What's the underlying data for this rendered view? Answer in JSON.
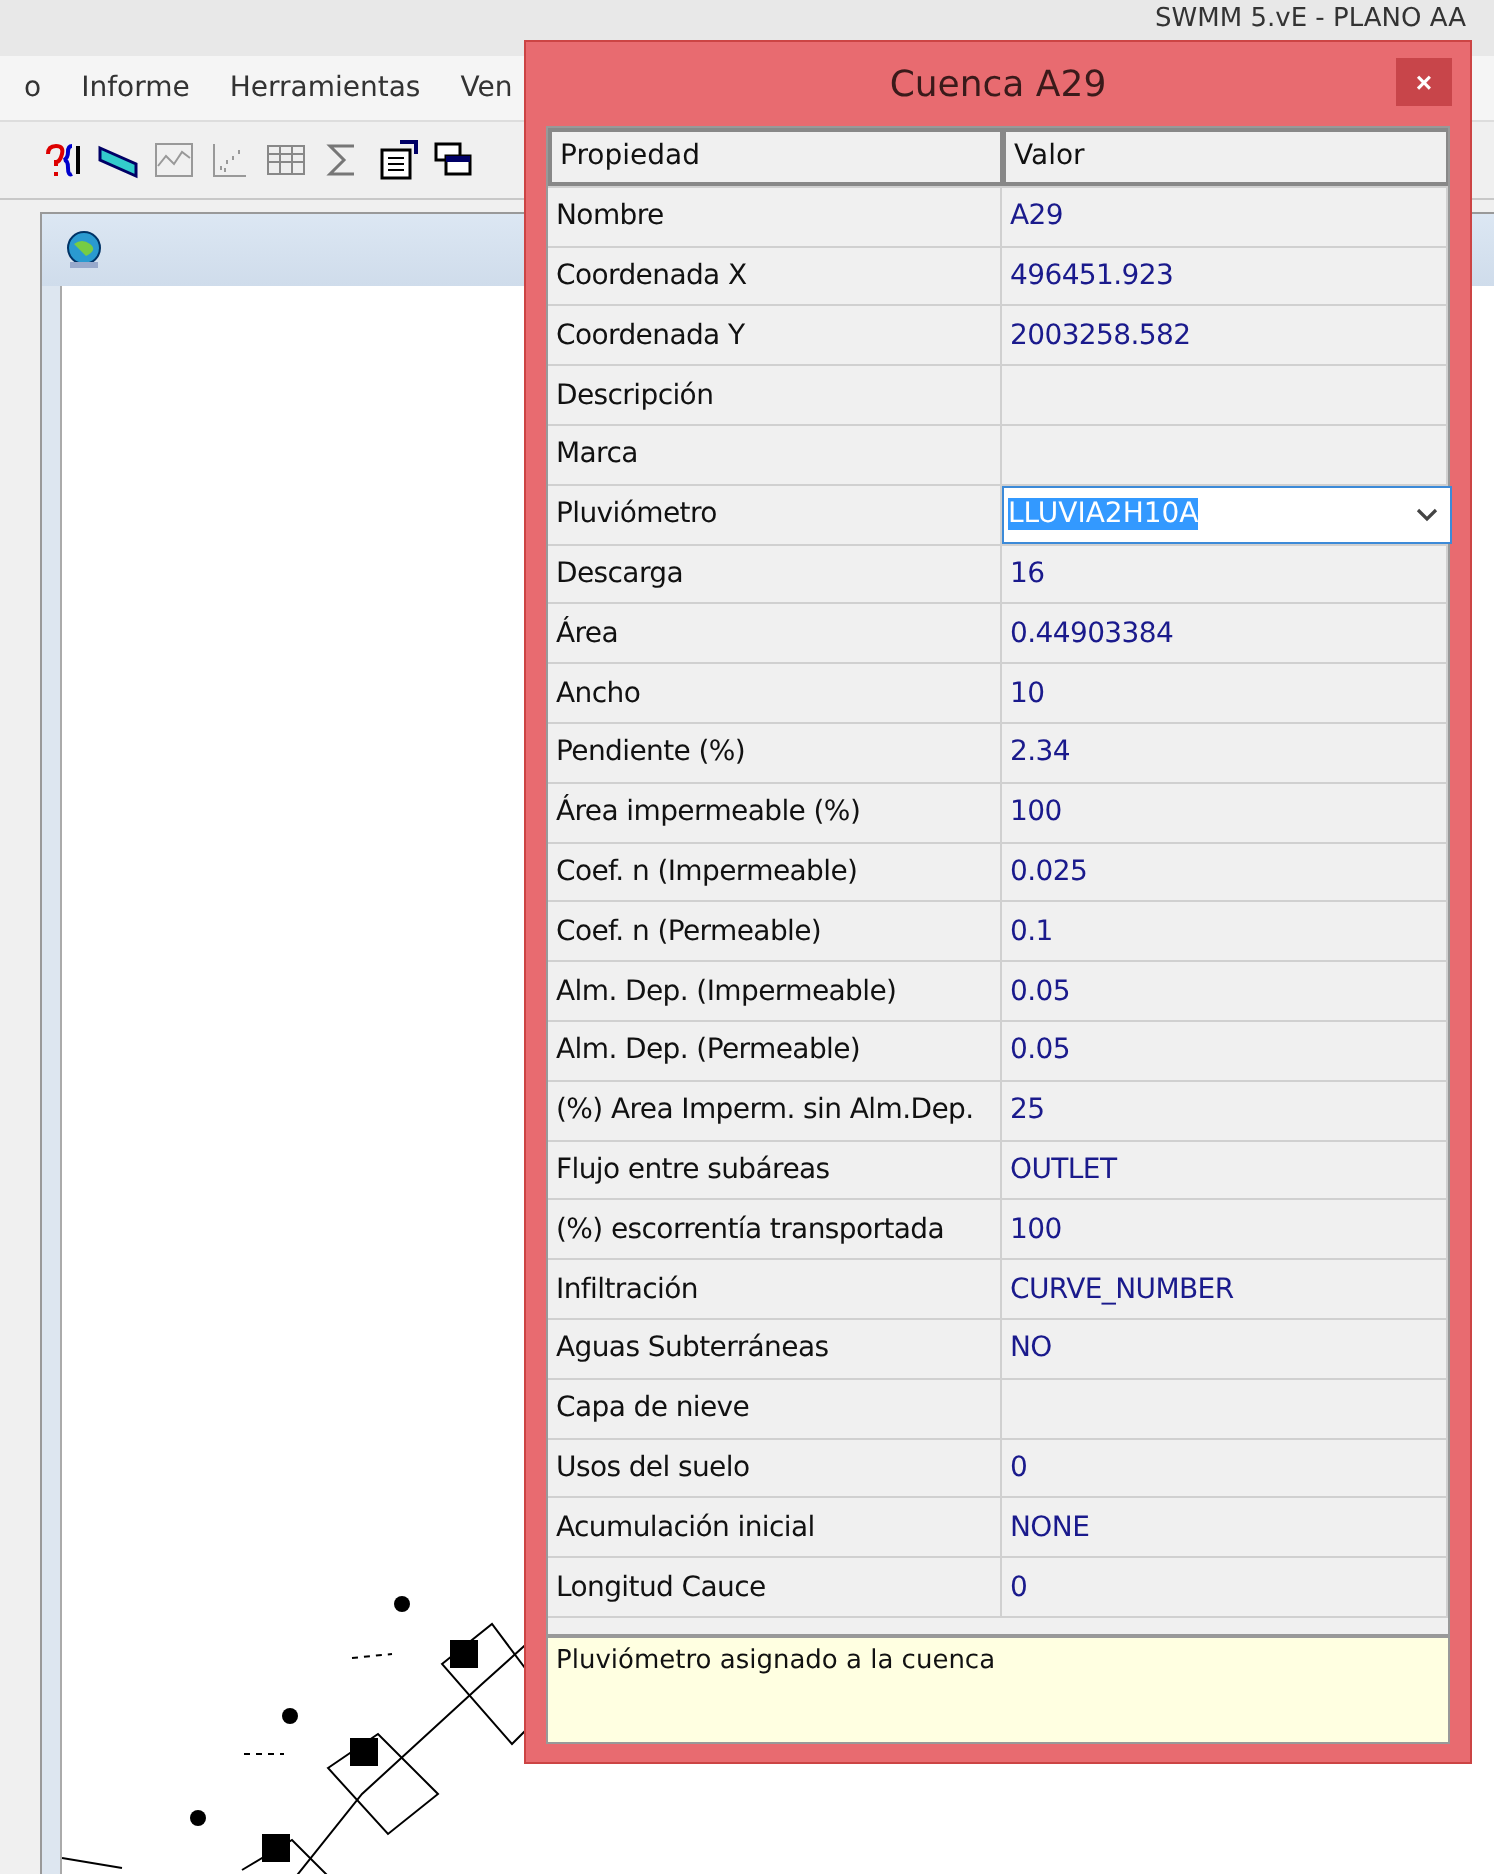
{
  "app": {
    "title": "SWMM 5.vE - PLANO AA",
    "menu": [
      "o",
      "Informe",
      "Herramientas",
      "Ven"
    ]
  },
  "dialog": {
    "title": "Cuenca A29",
    "close": "×",
    "columns": [
      "Propiedad",
      "Valor"
    ],
    "rows": [
      {
        "kind": "text",
        "property": "Nombre",
        "value": "A29"
      },
      {
        "kind": "text",
        "property": "Coordenada X",
        "value": "496451.923"
      },
      {
        "kind": "text",
        "property": "Coordenada Y",
        "value": "2003258.582"
      },
      {
        "kind": "text",
        "property": "Descripción",
        "value": ""
      },
      {
        "kind": "text",
        "property": "Marca",
        "value": ""
      },
      {
        "kind": "dropdown",
        "property": "Pluviómetro",
        "value": "LLUVIA2H10A"
      },
      {
        "kind": "text",
        "property": "Descarga",
        "value": "16"
      },
      {
        "kind": "text",
        "property": "Área",
        "value": "0.44903384"
      },
      {
        "kind": "text",
        "property": "Ancho",
        "value": "10"
      },
      {
        "kind": "text",
        "property": "Pendiente (%)",
        "value": "2.34"
      },
      {
        "kind": "text",
        "property": "Área impermeable (%)",
        "value": "100"
      },
      {
        "kind": "text",
        "property": "Coef. n (Impermeable)",
        "value": "0.025"
      },
      {
        "kind": "text",
        "property": "Coef. n (Permeable)",
        "value": "0.1"
      },
      {
        "kind": "text",
        "property": "Alm. Dep. (Impermeable)",
        "value": "0.05"
      },
      {
        "kind": "text",
        "property": "Alm. Dep. (Permeable)",
        "value": "0.05"
      },
      {
        "kind": "text",
        "property": "(%) Area Imperm. sin Alm.Dep.",
        "value": "25"
      },
      {
        "kind": "text",
        "property": "Flujo entre subáreas",
        "value": "OUTLET"
      },
      {
        "kind": "text",
        "property": "(%) escorrentía transportada",
        "value": "100"
      },
      {
        "kind": "text",
        "property": "Infiltración",
        "value": "CURVE_NUMBER"
      },
      {
        "kind": "text",
        "property": "Aguas Subterráneas",
        "value": "NO"
      },
      {
        "kind": "text",
        "property": "Capa de nieve",
        "value": ""
      },
      {
        "kind": "text",
        "property": "Usos del suelo",
        "value": "0"
      },
      {
        "kind": "text",
        "property": "Acumulación inicial",
        "value": "NONE"
      },
      {
        "kind": "text",
        "property": "Longitud Cauce",
        "value": "0"
      }
    ],
    "hint": "Pluviómetro asignado a la cuenca"
  }
}
